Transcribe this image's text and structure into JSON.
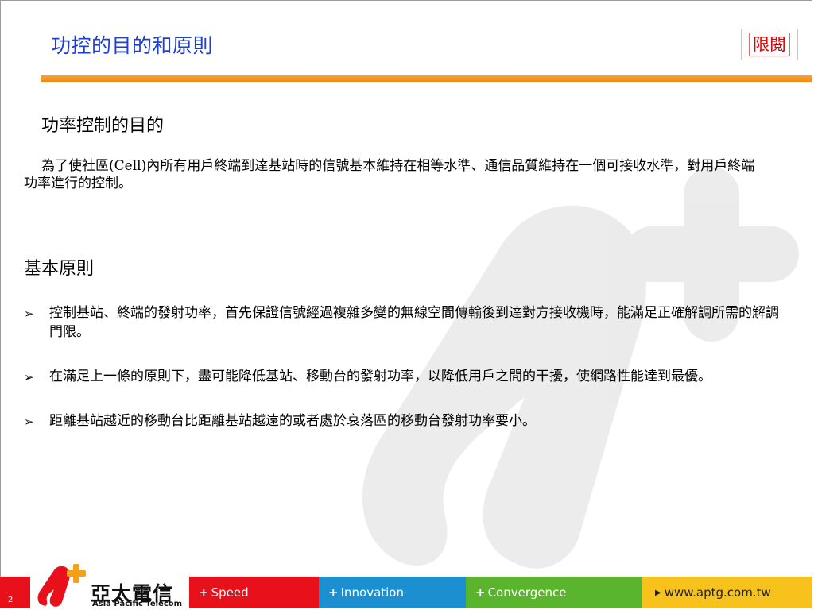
{
  "header": {
    "title": "功控的目的和原則",
    "classification_badge": "限閱"
  },
  "section_purpose": {
    "heading": "功率控制的目的",
    "paragraph": "為了使社區(Cell)內所有用戶終端到達基站時的信號基本維持在相等水準、通信品質維持在一個可接收水準，對用戶終端功率進行的控制。"
  },
  "section_principles": {
    "heading": "基本原則",
    "bullets": [
      "控制基站、終端的發射功率，首先保證信號經過複雜多變的無線空間傳輸後到達對方接收機時，能滿足正確解調所需的解調門限。",
      "在滿足上一條的原則下，盡可能降低基站、移動台的發射功率，以降低用戶之間的干擾，使網路性能達到最優。",
      "距離基站越近的移動台比距離基站越遠的或者處於衰落區的移動台發射功率要小。"
    ],
    "bullet_icon": "arrowhead-bullet-icon"
  },
  "footer": {
    "page_number": "2",
    "logo_cn": "亞太電信",
    "logo_en": "Asia Pacific Telecom",
    "segments": [
      "Speed",
      "Innovation",
      "Convergence"
    ],
    "website": "www.aptg.com.tw"
  },
  "colors": {
    "title_blue": "#1d3fd6",
    "badge_red": "#e00000",
    "bar_orange": "#f08a12",
    "footer_red": "#e8111b",
    "footer_blue": "#1b8fd0",
    "footer_green": "#5bb42e",
    "footer_yellow": "#f7c21c"
  }
}
